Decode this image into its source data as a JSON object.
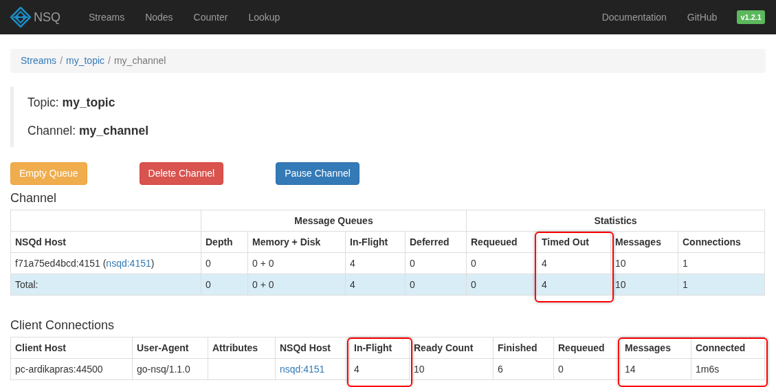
{
  "navbar": {
    "brand": "NSQ",
    "links": [
      {
        "label": "Streams"
      },
      {
        "label": "Nodes"
      },
      {
        "label": "Counter"
      },
      {
        "label": "Lookup"
      }
    ],
    "right_links": [
      {
        "label": "Documentation"
      },
      {
        "label": "GitHub"
      }
    ],
    "version": "v1.2.1"
  },
  "breadcrumb": {
    "separator": "/",
    "items": [
      {
        "label": "Streams",
        "link": true
      },
      {
        "label": "my_topic",
        "link": true
      },
      {
        "label": "my_channel",
        "link": false
      }
    ]
  },
  "summary": [
    {
      "label": "Topic:",
      "value": "my_topic"
    },
    {
      "label": "Channel:",
      "value": "my_channel"
    }
  ],
  "buttons": [
    {
      "label": "Empty Queue",
      "kind": "warning"
    },
    {
      "label": "Delete Channel",
      "kind": "danger"
    },
    {
      "label": "Pause Channel",
      "kind": "primary"
    }
  ],
  "channel_section": {
    "title": "Channel",
    "column_groups": [
      {
        "columns": [
          {
            "label": "NSQd Host",
            "highlighted": false
          }
        ]
      },
      {
        "label": "Message Queues",
        "columns": [
          {
            "label": "Depth",
            "highlighted": false
          },
          {
            "label": "Memory + Disk",
            "highlighted": false
          },
          {
            "label": "In-Flight",
            "highlighted": false
          },
          {
            "label": "Deferred",
            "highlighted": false
          }
        ]
      },
      {
        "label": "Statistics",
        "columns": [
          {
            "label": "Requeued",
            "highlighted": false
          },
          {
            "label": "Timed Out",
            "highlighted": true
          },
          {
            "label": "Messages",
            "highlighted": false
          },
          {
            "label": "Connections",
            "highlighted": false
          }
        ]
      }
    ],
    "rows": [
      {
        "kind": "node",
        "cells": [
          {
            "kind": "mixed",
            "parts": [
              {
                "text": "f71a75ed4bcd:4151 (",
                "link": false
              },
              {
                "text": "nsqd:4151",
                "link": true
              },
              {
                "text": ")",
                "link": false
              }
            ]
          },
          {
            "kind": "plain",
            "text": "0"
          },
          {
            "kind": "plain",
            "text": "0 + 0"
          },
          {
            "kind": "plain",
            "text": "4"
          },
          {
            "kind": "plain",
            "text": "0"
          },
          {
            "kind": "plain",
            "text": "0"
          },
          {
            "kind": "plain",
            "text": "4"
          },
          {
            "kind": "plain",
            "text": "10"
          },
          {
            "kind": "plain",
            "text": "1"
          }
        ]
      },
      {
        "kind": "total",
        "cells": [
          {
            "kind": "plain",
            "text": "Total:"
          },
          {
            "kind": "plain",
            "text": "0"
          },
          {
            "kind": "plain",
            "text": "0 + 0"
          },
          {
            "kind": "plain",
            "text": "4"
          },
          {
            "kind": "plain",
            "text": "0"
          },
          {
            "kind": "plain",
            "text": "0"
          },
          {
            "kind": "plain",
            "text": "4"
          },
          {
            "kind": "plain",
            "text": "10"
          },
          {
            "kind": "plain",
            "text": "1"
          }
        ]
      }
    ]
  },
  "clients_section": {
    "title": "Client Connections",
    "column_groups": [
      {
        "columns": [
          {
            "label": "Client Host",
            "highlighted": false
          },
          {
            "label": "User-Agent",
            "highlighted": false
          },
          {
            "label": "Attributes",
            "highlighted": false
          },
          {
            "label": "NSQd Host",
            "highlighted": false
          },
          {
            "label": "In-Flight",
            "highlighted": true
          },
          {
            "label": "Ready Count",
            "highlighted": false
          },
          {
            "label": "Finished",
            "highlighted": false
          },
          {
            "label": "Requeued",
            "highlighted": false
          },
          {
            "label": "Messages",
            "highlighted": true
          },
          {
            "label": "Connected",
            "highlighted": true
          }
        ]
      }
    ],
    "rows": [
      {
        "kind": "node",
        "cells": [
          {
            "kind": "plain",
            "text": "pc-ardikapras:44500"
          },
          {
            "kind": "small",
            "text": "go-nsq/1.1.0"
          },
          {
            "kind": "empty"
          },
          {
            "kind": "link",
            "text": "nsqd:4151"
          },
          {
            "kind": "plain",
            "text": "4"
          },
          {
            "kind": "plain",
            "text": "10"
          },
          {
            "kind": "plain",
            "text": "6"
          },
          {
            "kind": "plain",
            "text": "0"
          },
          {
            "kind": "plain",
            "text": "14"
          },
          {
            "kind": "plain",
            "text": "1m6s"
          }
        ]
      }
    ]
  }
}
